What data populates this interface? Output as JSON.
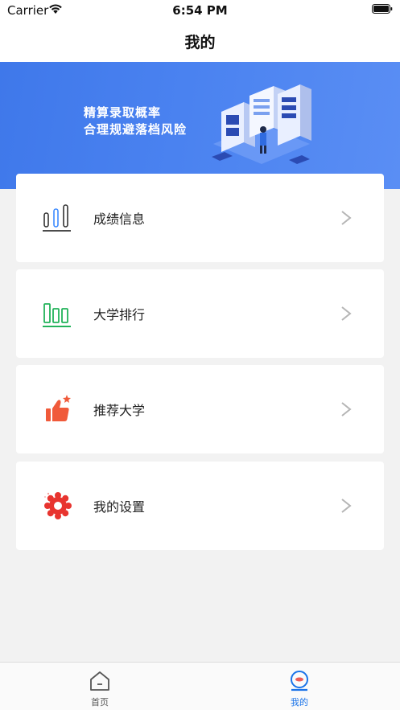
{
  "status_bar": {
    "carrier": "Carrier",
    "time": "6:54 PM"
  },
  "nav": {
    "title": "我的"
  },
  "banner": {
    "line1": "精算录取概率",
    "line2": "合理规避落档风险"
  },
  "menu": [
    {
      "label": "成绩信息",
      "icon": "bar-chart-icon",
      "color": "#333333"
    },
    {
      "label": "大学排行",
      "icon": "ranking-icon",
      "color": "#22b35a"
    },
    {
      "label": "推荐大学",
      "icon": "thumbs-up-icon",
      "color": "#f05a3a"
    },
    {
      "label": "我的设置",
      "icon": "gear-icon",
      "color": "#e8342f"
    }
  ],
  "tabs": [
    {
      "label": "首页",
      "icon": "home-icon",
      "active": false
    },
    {
      "label": "我的",
      "icon": "profile-icon",
      "active": true
    }
  ],
  "colors": {
    "accent": "#1a73e8",
    "inactive": "#555555",
    "banner": "#4a82f0"
  }
}
